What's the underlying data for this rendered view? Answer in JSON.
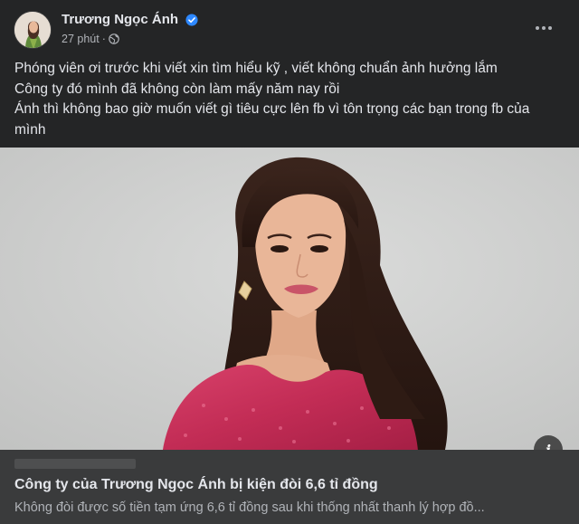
{
  "post": {
    "author": "Trương Ngọc Ánh",
    "timestamp": "27 phút",
    "separator": "·",
    "audience_icon": "globe-icon",
    "verified_icon": "verified-badge-icon",
    "more_icon": "more-options-icon",
    "text_lines": [
      "Phóng viên ơi trước khi viết xin tìm hiểu kỹ ,  viết không chuẩn ảnh hưởng lắm",
      "Công ty đó mình đã không còn làm mấy năm nay rồi",
      "Ánh thì không bao giờ muốn viết gì tiêu cực lên fb vì tôn trọng các bạn trong fb của",
      "mình"
    ]
  },
  "link_preview": {
    "title": "Công ty của Trương Ngọc Ánh bị kiện đòi 6,6 tỉ đồng",
    "description": "Không đòi được số tiền tạm ứng 6,6 tỉ đồng sau khi thống nhất thanh lý hợp đồ...",
    "info_label": "i",
    "info_icon": "info-icon"
  },
  "colors": {
    "background": "#242526",
    "link_box": "#3a3b3c",
    "primary_text": "#e4e6eb",
    "secondary_text": "#b0b3b8",
    "verified": "#2d88ff",
    "image_bg": "#cfd0cf",
    "dress": "#c8315a"
  }
}
